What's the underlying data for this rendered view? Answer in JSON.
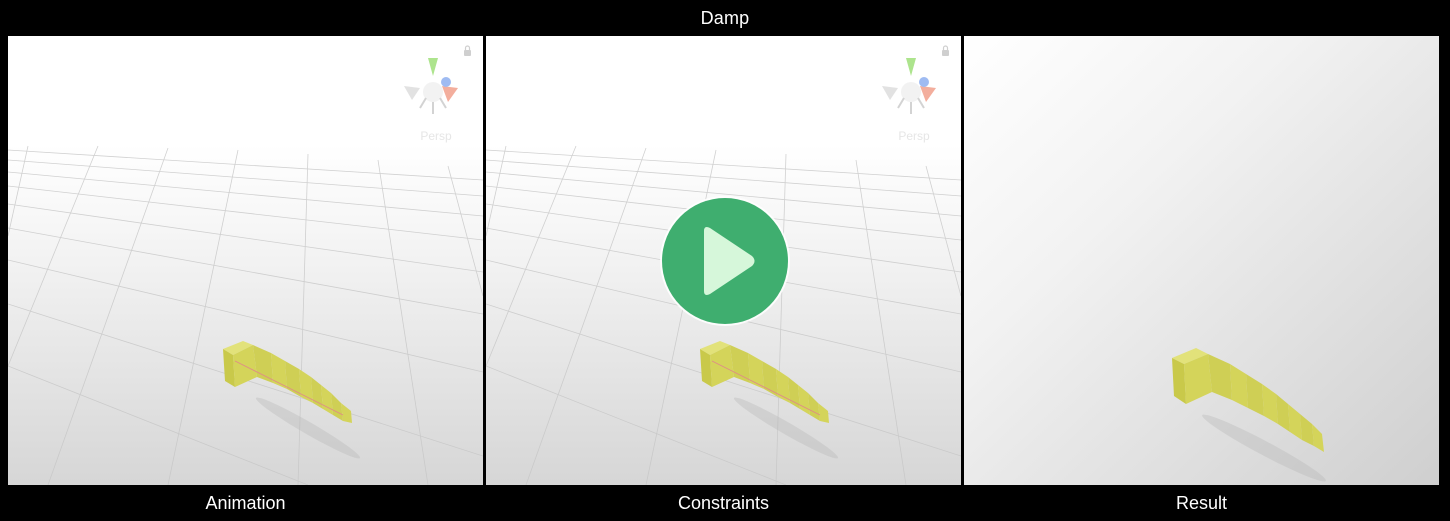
{
  "title": "Damp",
  "panels": [
    {
      "caption": "Animation",
      "view_label": "Persp"
    },
    {
      "caption": "Constraints",
      "view_label": "Persp"
    },
    {
      "caption": "Result"
    }
  ],
  "play_button": {
    "icon": "play-icon",
    "color": "#3fae6f"
  },
  "colors": {
    "background": "#000000",
    "bone_chain": "#d4d45a",
    "grid_line": "#c9c9c9"
  }
}
